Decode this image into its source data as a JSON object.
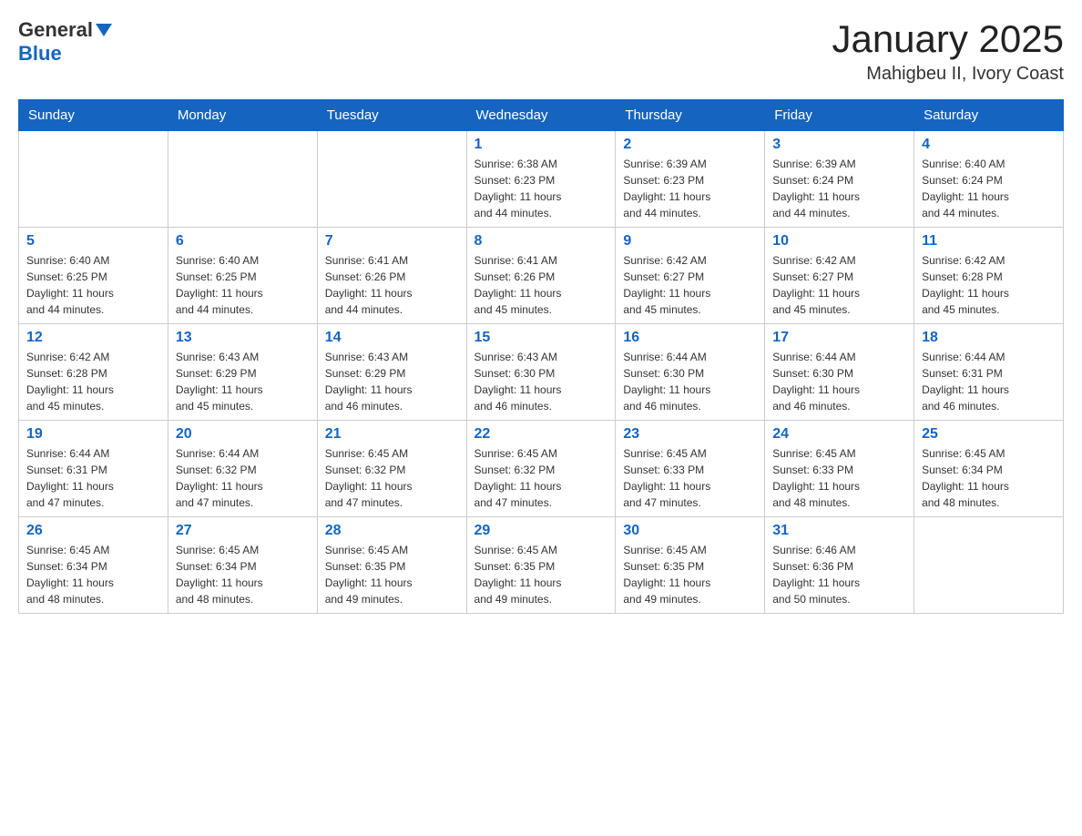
{
  "header": {
    "logo_general": "General",
    "logo_blue": "Blue",
    "title": "January 2025",
    "subtitle": "Mahigbeu II, Ivory Coast"
  },
  "days_of_week": [
    "Sunday",
    "Monday",
    "Tuesday",
    "Wednesday",
    "Thursday",
    "Friday",
    "Saturday"
  ],
  "weeks": [
    [
      {
        "day": "",
        "info": ""
      },
      {
        "day": "",
        "info": ""
      },
      {
        "day": "",
        "info": ""
      },
      {
        "day": "1",
        "info": "Sunrise: 6:38 AM\nSunset: 6:23 PM\nDaylight: 11 hours\nand 44 minutes."
      },
      {
        "day": "2",
        "info": "Sunrise: 6:39 AM\nSunset: 6:23 PM\nDaylight: 11 hours\nand 44 minutes."
      },
      {
        "day": "3",
        "info": "Sunrise: 6:39 AM\nSunset: 6:24 PM\nDaylight: 11 hours\nand 44 minutes."
      },
      {
        "day": "4",
        "info": "Sunrise: 6:40 AM\nSunset: 6:24 PM\nDaylight: 11 hours\nand 44 minutes."
      }
    ],
    [
      {
        "day": "5",
        "info": "Sunrise: 6:40 AM\nSunset: 6:25 PM\nDaylight: 11 hours\nand 44 minutes."
      },
      {
        "day": "6",
        "info": "Sunrise: 6:40 AM\nSunset: 6:25 PM\nDaylight: 11 hours\nand 44 minutes."
      },
      {
        "day": "7",
        "info": "Sunrise: 6:41 AM\nSunset: 6:26 PM\nDaylight: 11 hours\nand 44 minutes."
      },
      {
        "day": "8",
        "info": "Sunrise: 6:41 AM\nSunset: 6:26 PM\nDaylight: 11 hours\nand 45 minutes."
      },
      {
        "day": "9",
        "info": "Sunrise: 6:42 AM\nSunset: 6:27 PM\nDaylight: 11 hours\nand 45 minutes."
      },
      {
        "day": "10",
        "info": "Sunrise: 6:42 AM\nSunset: 6:27 PM\nDaylight: 11 hours\nand 45 minutes."
      },
      {
        "day": "11",
        "info": "Sunrise: 6:42 AM\nSunset: 6:28 PM\nDaylight: 11 hours\nand 45 minutes."
      }
    ],
    [
      {
        "day": "12",
        "info": "Sunrise: 6:42 AM\nSunset: 6:28 PM\nDaylight: 11 hours\nand 45 minutes."
      },
      {
        "day": "13",
        "info": "Sunrise: 6:43 AM\nSunset: 6:29 PM\nDaylight: 11 hours\nand 45 minutes."
      },
      {
        "day": "14",
        "info": "Sunrise: 6:43 AM\nSunset: 6:29 PM\nDaylight: 11 hours\nand 46 minutes."
      },
      {
        "day": "15",
        "info": "Sunrise: 6:43 AM\nSunset: 6:30 PM\nDaylight: 11 hours\nand 46 minutes."
      },
      {
        "day": "16",
        "info": "Sunrise: 6:44 AM\nSunset: 6:30 PM\nDaylight: 11 hours\nand 46 minutes."
      },
      {
        "day": "17",
        "info": "Sunrise: 6:44 AM\nSunset: 6:30 PM\nDaylight: 11 hours\nand 46 minutes."
      },
      {
        "day": "18",
        "info": "Sunrise: 6:44 AM\nSunset: 6:31 PM\nDaylight: 11 hours\nand 46 minutes."
      }
    ],
    [
      {
        "day": "19",
        "info": "Sunrise: 6:44 AM\nSunset: 6:31 PM\nDaylight: 11 hours\nand 47 minutes."
      },
      {
        "day": "20",
        "info": "Sunrise: 6:44 AM\nSunset: 6:32 PM\nDaylight: 11 hours\nand 47 minutes."
      },
      {
        "day": "21",
        "info": "Sunrise: 6:45 AM\nSunset: 6:32 PM\nDaylight: 11 hours\nand 47 minutes."
      },
      {
        "day": "22",
        "info": "Sunrise: 6:45 AM\nSunset: 6:32 PM\nDaylight: 11 hours\nand 47 minutes."
      },
      {
        "day": "23",
        "info": "Sunrise: 6:45 AM\nSunset: 6:33 PM\nDaylight: 11 hours\nand 47 minutes."
      },
      {
        "day": "24",
        "info": "Sunrise: 6:45 AM\nSunset: 6:33 PM\nDaylight: 11 hours\nand 48 minutes."
      },
      {
        "day": "25",
        "info": "Sunrise: 6:45 AM\nSunset: 6:34 PM\nDaylight: 11 hours\nand 48 minutes."
      }
    ],
    [
      {
        "day": "26",
        "info": "Sunrise: 6:45 AM\nSunset: 6:34 PM\nDaylight: 11 hours\nand 48 minutes."
      },
      {
        "day": "27",
        "info": "Sunrise: 6:45 AM\nSunset: 6:34 PM\nDaylight: 11 hours\nand 48 minutes."
      },
      {
        "day": "28",
        "info": "Sunrise: 6:45 AM\nSunset: 6:35 PM\nDaylight: 11 hours\nand 49 minutes."
      },
      {
        "day": "29",
        "info": "Sunrise: 6:45 AM\nSunset: 6:35 PM\nDaylight: 11 hours\nand 49 minutes."
      },
      {
        "day": "30",
        "info": "Sunrise: 6:45 AM\nSunset: 6:35 PM\nDaylight: 11 hours\nand 49 minutes."
      },
      {
        "day": "31",
        "info": "Sunrise: 6:46 AM\nSunset: 6:36 PM\nDaylight: 11 hours\nand 50 minutes."
      },
      {
        "day": "",
        "info": ""
      }
    ]
  ]
}
